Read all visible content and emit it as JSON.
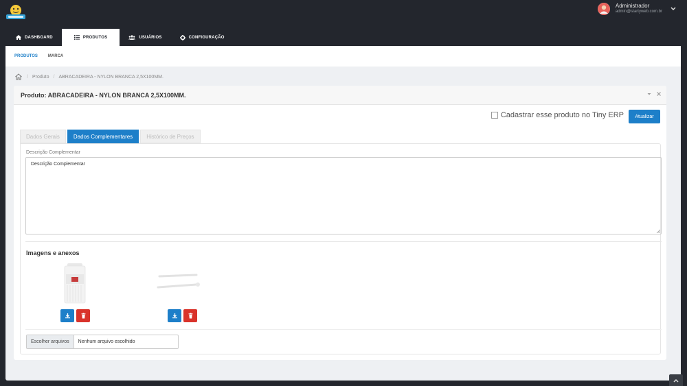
{
  "brand": {
    "logo_icon": "smiley-logo-icon",
    "accent": "#1d7fc9",
    "danger": "#d9332b",
    "topbar_bg": "#23262d"
  },
  "user": {
    "name": "Administrador",
    "email": "admin@startyweb.com.br"
  },
  "nav": [
    {
      "label": "DASHBOARD",
      "icon": "home-icon"
    },
    {
      "label": "PRODUTOS",
      "icon": "list-icon",
      "active": true
    },
    {
      "label": "USUÁRIOS",
      "icon": "users-icon"
    },
    {
      "label": "CONFIGURAÇÃO",
      "icon": "gear-icon"
    }
  ],
  "subnav": [
    {
      "label": "PRODUTOS",
      "active": true
    },
    {
      "label": "MARCA"
    }
  ],
  "breadcrumb": {
    "items": [
      "Produto",
      "ABRACADEIRA - NYLON BRANCA 2,5X100MM."
    ]
  },
  "card": {
    "title": "Produto: ABRACADEIRA - NYLON BRANCA 2,5X100MM.",
    "tiny_checkbox_label": "Cadastrar esse produto no Tiny ERP",
    "update_button": "Atualizar"
  },
  "tabs": [
    {
      "label": "Dados Gerais"
    },
    {
      "label": "Dados Complementares",
      "active": true
    },
    {
      "label": "Histórico de Preços"
    }
  ],
  "description": {
    "label": "Descrição Complementar",
    "value": "Descrição Complementar"
  },
  "images": {
    "title": "Imagens e anexos"
  },
  "file_input": {
    "button": "Escolher arquivos",
    "status": "Nenhum arquivo escolhido"
  }
}
